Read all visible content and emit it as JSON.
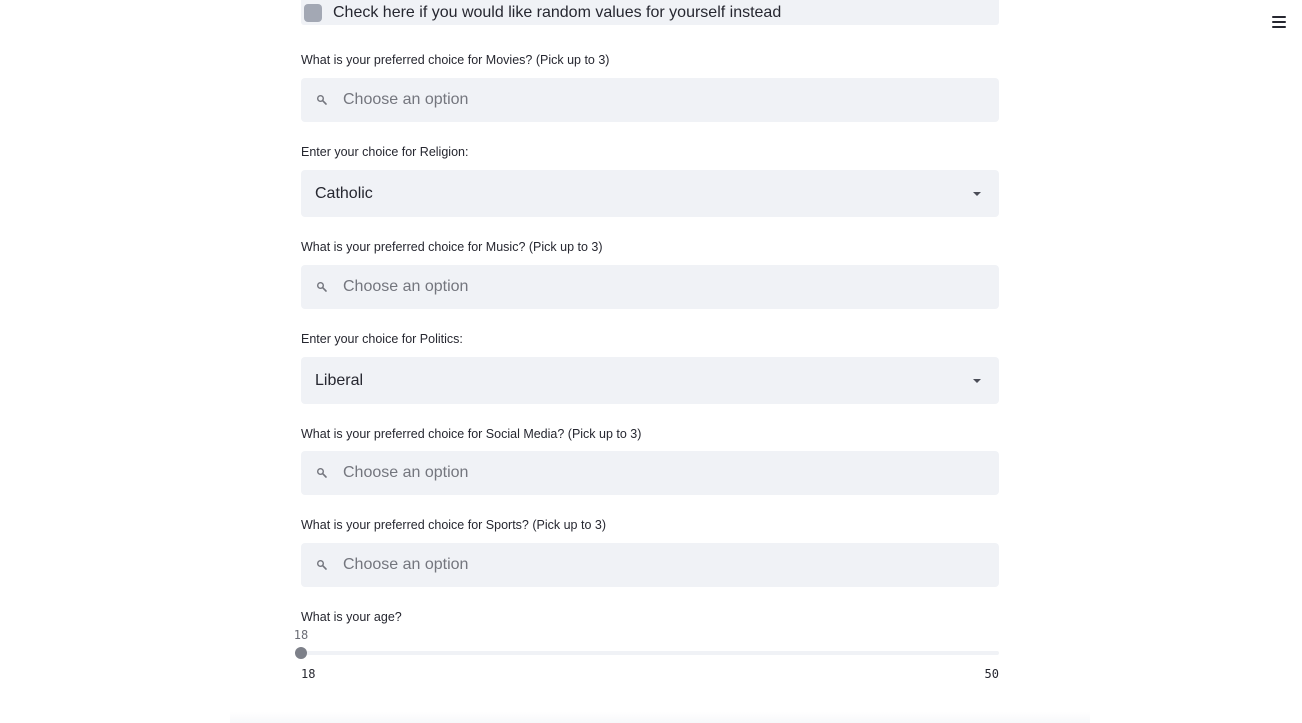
{
  "header": {
    "menu_icon": "hamburger-menu-icon"
  },
  "random_checkbox": {
    "label": "Check here if you would like random values for yourself instead",
    "checked": false
  },
  "movies": {
    "label": "What is your preferred choice for Movies? (Pick up to 3)",
    "placeholder": "Choose an option",
    "icon": "search-icon"
  },
  "religion": {
    "label": "Enter your choice for Religion:",
    "value": "Catholic",
    "icon": "chevron-down-icon"
  },
  "music": {
    "label": "What is your preferred choice for Music? (Pick up to 3)",
    "placeholder": "Choose an option",
    "icon": "search-icon"
  },
  "politics": {
    "label": "Enter your choice for Politics:",
    "value": "Liberal",
    "icon": "chevron-down-icon"
  },
  "social_media": {
    "label": "What is your preferred choice for Social Media? (Pick up to 3)",
    "placeholder": "Choose an option",
    "icon": "search-icon"
  },
  "sports": {
    "label": "What is your preferred choice for Sports? (Pick up to 3)",
    "placeholder": "Choose an option",
    "icon": "search-icon"
  },
  "age": {
    "label": "What is your age?",
    "value": "18",
    "min": "18",
    "max": "50"
  },
  "colors": {
    "input_bg": "#f0f2f6",
    "text": "#262730",
    "placeholder": "#74767e",
    "slider_thumb": "#7d8089"
  }
}
